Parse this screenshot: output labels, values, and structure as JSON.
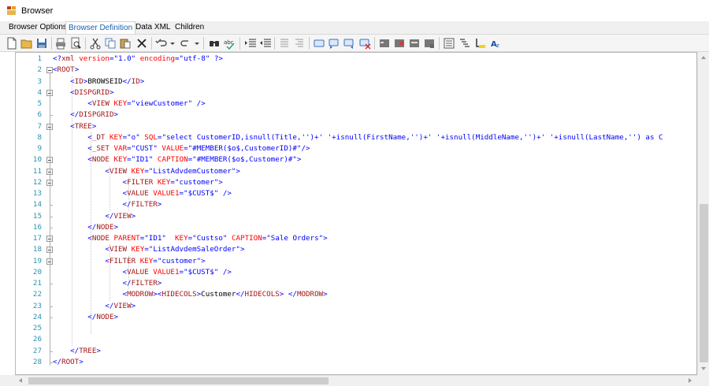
{
  "window": {
    "title": "Browser",
    "icon": "app-window-icon"
  },
  "tabs": [
    {
      "label": "Browser Options",
      "active": false
    },
    {
      "label": "Browser Definition",
      "active": true
    },
    {
      "label": "Data XML",
      "active": false
    },
    {
      "label": "Children",
      "active": false
    }
  ],
  "toolbar": {
    "icons": [
      "new-file-icon",
      "open-folder-icon",
      "save-icon",
      "print-icon",
      "print-preview-icon",
      "cut-icon",
      "copy-icon",
      "paste-icon",
      "delete-icon",
      "undo-icon",
      "redo-icon",
      "find-icon",
      "spell-check-icon",
      "indent-icon",
      "outdent-icon",
      "comment-icon",
      "uncomment-icon",
      "toggle-bookmark-icon",
      "previous-bookmark-icon",
      "next-bookmark-icon",
      "clear-bookmarks-icon",
      "toggle-breakpoint-icon",
      "previous-breakpoint-icon",
      "next-breakpoint-icon",
      "clear-breakpoints-icon",
      "properties-icon",
      "format-icon",
      "highlight-icon",
      "font-icon"
    ]
  },
  "editor": {
    "lines": [
      "<?xml version=\"1.0\" encoding=\"utf-8\" ?>",
      "<ROOT>",
      "    <ID>BROWSEID</ID>",
      "    <DISPGRID>",
      "        <VIEW KEY=\"viewCustomer\" />",
      "    </DISPGRID>",
      "    <TREE>",
      "        <_DT KEY=\"o\" SQL=\"select CustomerID,isnull(Title,'')+' '+isnull(FirstName,'')+' '+isnull(MiddleName,'')+' '+isnull(LastName,'') as C",
      "        <_SET VAR=\"CUST\" VALUE=\"#MEMBER($o$,CustomerID)#\"/>",
      "        <NODE KEY=\"ID1\" CAPTION=\"#MEMBER($o$,Customer)#\">",
      "            <VIEW KEY=\"ListAdvdemCustomer\">",
      "                <FILTER KEY=\"customer\">",
      "                <VALUE VALUE1=\"$CUST$\" />",
      "                </FILTER>",
      "            </VIEW>",
      "        </NODE>",
      "        <NODE PARENT=\"ID1\"  KEY=\"Custso\" CAPTION=\"Sale Orders\">",
      "            <VIEW KEY=\"ListAdvdemSaleOrder\">",
      "            <FILTER KEY=\"customer\">",
      "                <VALUE VALUE1=\"$CUST$\" />",
      "                </FILTER>",
      "                <MODROW><HIDECOLS>Customer</HIDECOLS> </MODROW>",
      "            </VIEW>",
      "        </NODE>",
      "",
      "",
      "    </TREE>",
      "</ROOT>"
    ]
  },
  "colors": {
    "line_number": "#2b91af",
    "bracket": "#0000ff",
    "tag": "#a31515",
    "attribute": "#ff0000",
    "attribute_value": "#0000ff",
    "active_tab_text": "#1a5fb4"
  }
}
